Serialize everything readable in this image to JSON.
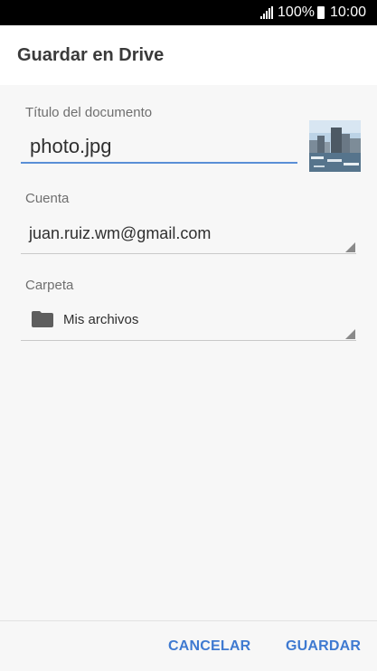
{
  "status_bar": {
    "battery_percent": "100%",
    "time": "10:00",
    "signal_icon": "signal-icon",
    "battery_icon": "battery-icon"
  },
  "header": {
    "title": "Guardar en Drive"
  },
  "form": {
    "title_label": "Título del documento",
    "title_value": "photo.jpg",
    "account_label": "Cuenta",
    "account_value": "juan.ruiz.wm@gmail.com",
    "folder_label": "Carpeta",
    "folder_value": "Mis archivos",
    "folder_icon": "folder-icon",
    "thumbnail_icon": "image-thumbnail"
  },
  "actions": {
    "cancel_label": "CANCELAR",
    "save_label": "GUARDAR"
  },
  "colors": {
    "accent": "#3f7ad1",
    "active_underline": "#5a8fd6"
  }
}
